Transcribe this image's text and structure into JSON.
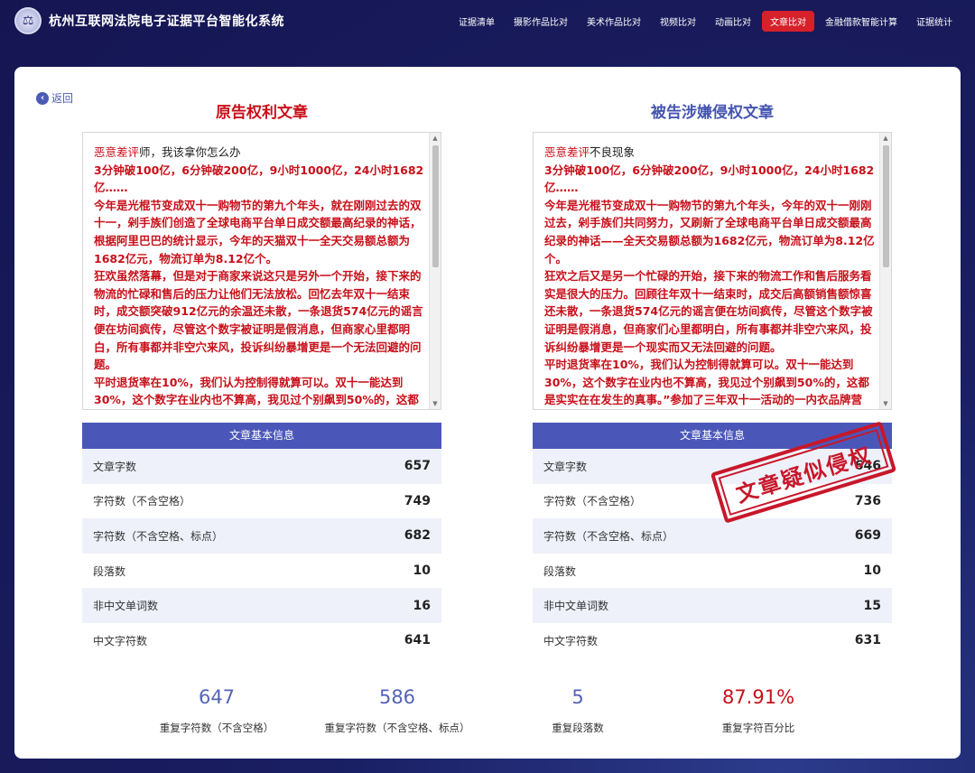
{
  "header": {
    "title": "杭州互联网法院电子证据平台智能化系统",
    "nav": [
      {
        "label": "证据清单",
        "active": false
      },
      {
        "label": "摄影作品比对",
        "active": false
      },
      {
        "label": "美术作品比对",
        "active": false
      },
      {
        "label": "视频比对",
        "active": false
      },
      {
        "label": "动画比对",
        "active": false
      },
      {
        "label": "文章比对",
        "active": true
      },
      {
        "label": "金融借款智能计算",
        "active": false
      },
      {
        "label": "证据统计",
        "active": false
      }
    ]
  },
  "back_label": "返回",
  "left": {
    "title": "原告权利文章",
    "first_line_red": "恶意差评",
    "first_line_rest": "师，我该拿你怎么办",
    "paragraphs": [
      "3分钟破100亿，6分钟破200亿，9小时1000亿，24小时1682亿……",
      "今年是光棍节变成双十一购物节的第九个年头，就在刚刚过去的双十一，剁手族们创造了全球电商平台单日成交额最高纪录的神话，根据阿里巴巴的统计显示，今年的天猫双十一全天交易额总额为1682亿元，物流订单为8.12亿个。",
      "狂欢虽然落幕，但是对于商家来说这只是另外一个开始，接下来的物流的忙碌和售后的压力让他们无法放松。回忆去年双十一结束时，成交额突破912亿元的余温还未散，一条退货574亿元的谣言便在坊间疯传，尽管这个数字被证明是假消息，但商家心里都明白，所有事都并非空穴来风，投诉纠纷暴增更是一个无法回避的问题。",
      "平时退货率在10%，我们认为控制得就算可以。双十一能达到30%，这个数字在业内也不算高，我见过个别飙到50%的，这都"
    ],
    "info_title": "文章基本信息",
    "info": [
      {
        "label": "文章字数",
        "value": "657"
      },
      {
        "label": "字符数（不含空格）",
        "value": "749"
      },
      {
        "label": "字符数（不含空格、标点）",
        "value": "682"
      },
      {
        "label": "段落数",
        "value": "10"
      },
      {
        "label": "非中文单词数",
        "value": "16"
      },
      {
        "label": "中文字符数",
        "value": "641"
      }
    ]
  },
  "right": {
    "title": "被告涉嫌侵权文章",
    "first_line_red": "恶意差评",
    "first_line_rest": "不良现象",
    "paragraphs": [
      "3分钟破100亿，6分钟破200亿，9小时1000亿，24小时1682亿……",
      "今年是光棍节变成双十一购物节的第九个年头，今年的双十一刚刚过去，剁手族们共同努力，又刷新了全球电商平台单日成交额最高纪录的神话——全天交易额总额为1682亿元，物流订单为8.12亿个。",
      "狂欢之后又是另一个忙碌的开始，接下来的物流工作和售后服务看实是很大的压力。回顾往年双十一结束时，成交后高额销售额惊喜还未散，一条退货574亿元的谣言便在坊间疯传，尽管这个数字被证明是假消息，但商家们心里都明白，所有事都并非空穴来风，投诉纠纷暴增更是一个现实而又无法回避的问题。",
      "平时退货率在10%，我们认为控制得就算可以。双十一能达到30%，这个数字在业内也不算高，我见过个别飙到50%的，这都是实实在在发生的真事。”参加了三年双十一活动的一内衣品牌营"
    ],
    "info_title": "文章基本信息",
    "info": [
      {
        "label": "文章字数",
        "value": "646"
      },
      {
        "label": "字符数（不含空格）",
        "value": "736"
      },
      {
        "label": "字符数（不含空格、标点）",
        "value": "669"
      },
      {
        "label": "段落数",
        "value": "10"
      },
      {
        "label": "非中文单词数",
        "value": "15"
      },
      {
        "label": "中文字符数",
        "value": "631"
      }
    ]
  },
  "stamp_text": "文章疑似侵权",
  "stats": [
    {
      "value": "647",
      "label": "重复字符数（不含空格）",
      "color": "#5563b8"
    },
    {
      "value": "586",
      "label": "重复字符数（不含空格、标点）",
      "color": "#5563b8"
    },
    {
      "value": "5",
      "label": "重复段落数",
      "color": "#5563b8"
    },
    {
      "value": "87.91%",
      "label": "重复字符百分比",
      "color": "#c8101a"
    }
  ]
}
